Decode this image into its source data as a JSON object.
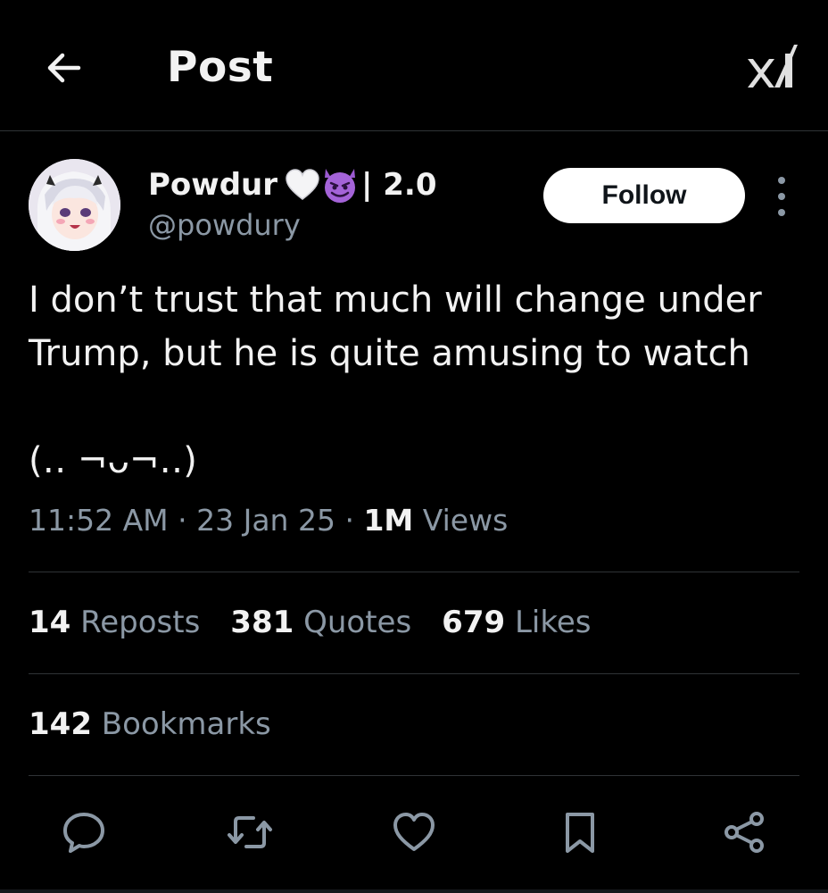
{
  "header": {
    "title": "Post",
    "back_icon": "arrow-left-icon",
    "logo_icon": "xai-logo"
  },
  "author": {
    "display_name": "Powdur",
    "name_emojis": [
      "white-heart-emoji",
      "smiling-devil-emoji"
    ],
    "name_suffix": "| 2.0",
    "handle": "@powdury",
    "avatar": "anime-girl-avatar"
  },
  "actions_top": {
    "follow_label": "Follow",
    "more_icon": "more-vertical-icon"
  },
  "post": {
    "text": "I don’t trust that much will change under Trump, but he is quite amusing to watch\n\n(‥ ¬ᴗ¬‥)"
  },
  "meta": {
    "time": "11:52 AM",
    "sep1": " · ",
    "date": "23 Jan 25",
    "sep2": " · ",
    "views_count": "1M",
    "views_label": " Views"
  },
  "stats": {
    "reposts_count": "14",
    "reposts_label": " Reposts",
    "quotes_count": "381",
    "quotes_label": " Quotes",
    "likes_count": "679",
    "likes_label": " Likes",
    "bookmarks_count": "142",
    "bookmarks_label": " Bookmarks"
  },
  "action_bar": [
    "reply-icon",
    "repost-icon",
    "like-icon",
    "bookmark-icon",
    "share-icon"
  ],
  "colors": {
    "background": "#000000",
    "text_primary": "#f2f2f2",
    "text_secondary": "#8b98a5",
    "divider": "#2f3336",
    "follow_bg": "#ffffff"
  }
}
